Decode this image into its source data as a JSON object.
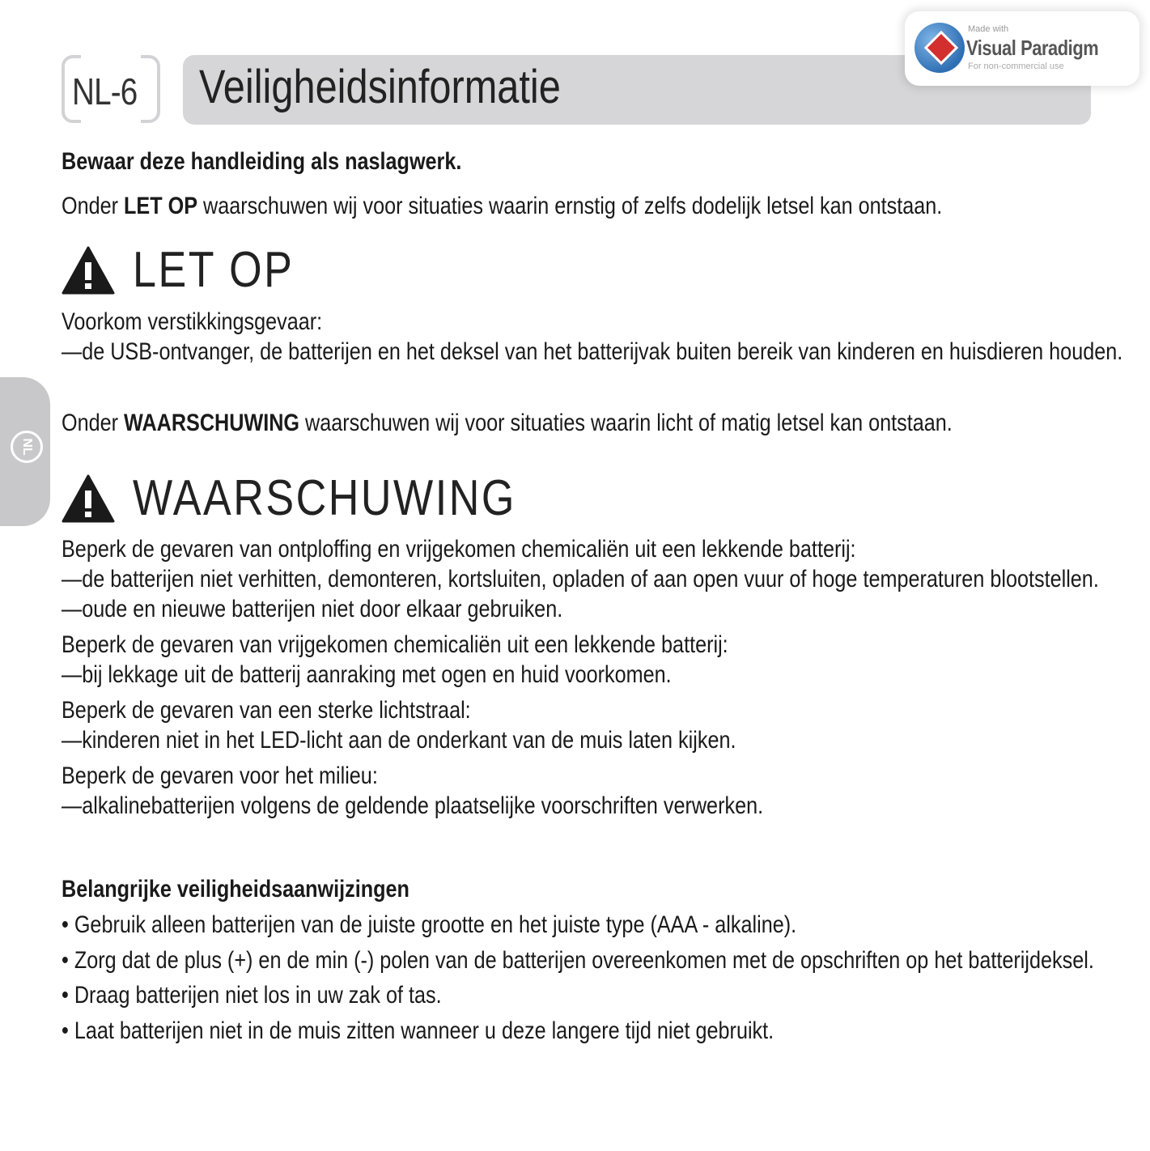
{
  "header": {
    "page_number": "NL-6",
    "title": "Veiligheidsinformatie"
  },
  "watermark": {
    "small": "Made with",
    "main": "Visual Paradigm",
    "sub": "For non-commercial use"
  },
  "side_tab": {
    "label": "NL"
  },
  "intro": {
    "keep": "Bewaar deze handleiding als naslagwerk.",
    "letop_prefix": "Onder ",
    "letop_bold": "LET OP",
    "letop_suffix": " waarschuwen wij voor situaties waarin ernstig of zelfs dodelijk letsel kan ontstaan."
  },
  "letop": {
    "heading": "LET OP",
    "lines": [
      "Voorkom verstikkingsgevaar:",
      "—de USB-ontvanger, de batterijen en het deksel van het batterijvak buiten bereik van kinderen en huisdieren houden."
    ]
  },
  "waarschuwing_intro": {
    "prefix": "Onder ",
    "bold": "WAARSCHUWING",
    "suffix": " waarschuwen wij voor situaties waarin licht of matig letsel kan ontstaan."
  },
  "waarschuwing": {
    "heading": "WAARSCHUWING",
    "lines": [
      "Beperk de gevaren van ontploffing en vrijgekomen chemicaliën uit een lekkende batterij:",
      "—de batterijen niet verhitten, demonteren, kortsluiten, opladen of aan open vuur of hoge temperaturen blootstellen.",
      "—oude en nieuwe batterijen niet door elkaar gebruiken.",
      "Beperk de gevaren van vrijgekomen chemicaliën uit een lekkende batterij:",
      "—bij lekkage uit de batterij aanraking met ogen en huid voorkomen.",
      "Beperk de gevaren van een sterke lichtstraal:",
      "—kinderen niet in het LED-licht aan de onderkant van de muis laten kijken.",
      "Beperk de gevaren voor het milieu:",
      "—alkalinebatterijen volgens de geldende plaatselijke voorschriften verwerken."
    ]
  },
  "instructions": {
    "heading": "Belangrijke veiligheidsaanwijzingen",
    "items": [
      "• Gebruik alleen batterijen van de juiste grootte en het juiste type (AAA - alkaline).",
      "• Zorg dat de plus (+) en de min (-) polen van de batterijen overeenkomen met de opschriften op het batterijdeksel.",
      "• Draag batterijen niet los in uw zak of tas.",
      "• Laat batterijen niet in de muis zitten wanneer u deze langere tijd niet gebruikt."
    ]
  }
}
